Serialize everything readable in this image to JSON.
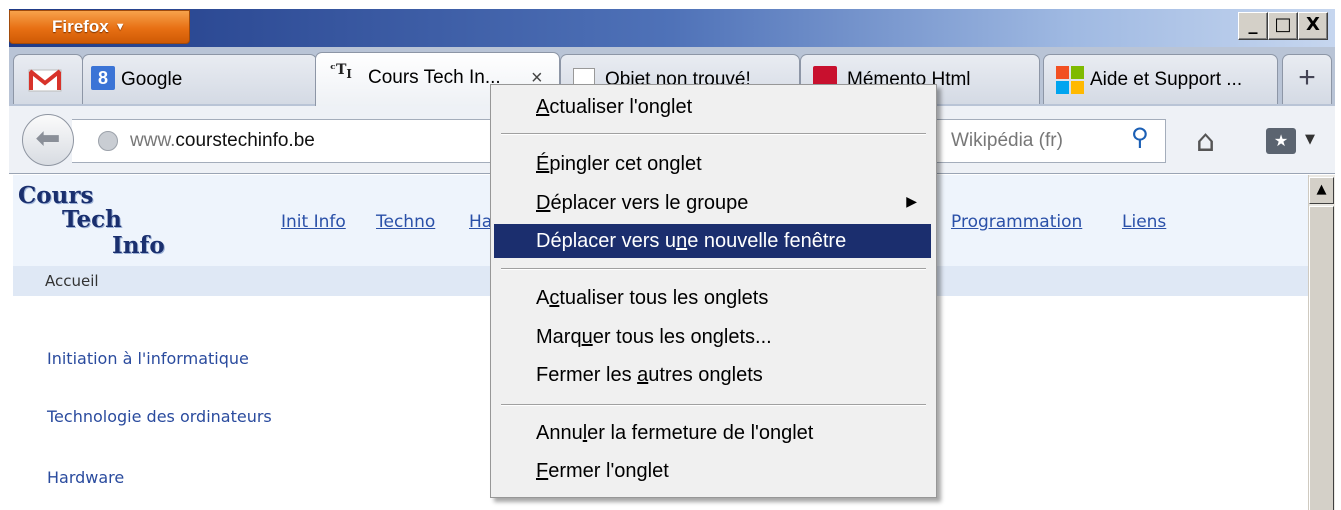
{
  "window": {
    "firefox_button": "Firefox",
    "controls": [
      "_",
      "□",
      "X"
    ]
  },
  "tabs": [
    {
      "label": "",
      "icon": "gmail-icon"
    },
    {
      "label": "Google",
      "icon": "google-icon"
    },
    {
      "label": "Cours Tech In...",
      "icon": "cti-icon",
      "close": "×"
    },
    {
      "label": "Objet non trouvé!",
      "icon": "blank-page-icon"
    },
    {
      "label": "Mémento Html",
      "icon": "pdf-icon"
    },
    {
      "label": "Aide et Support ...",
      "icon": "windows-icon"
    }
  ],
  "new_tab_label": "+",
  "navbar": {
    "url_prefix": "www.",
    "url_domain": "courstechinfo.be",
    "search_placeholder": "Wikipédia (fr)"
  },
  "site": {
    "logo": [
      "Cours",
      "Tech",
      "Info"
    ],
    "nav": [
      "Init Info",
      "Techno",
      "Ha",
      "Programmation",
      "Liens"
    ],
    "breadcrumb": "Accueil",
    "links": [
      "Initiation à l'informatique",
      "Technologie des ordinateurs",
      "Hardware"
    ]
  },
  "context_menu": {
    "items": [
      {
        "pre": "",
        "key": "A",
        "post": "ctualiser l'onglet"
      },
      {
        "pre": "",
        "key": "É",
        "post": "pingler cet onglet"
      },
      {
        "pre": "",
        "key": "D",
        "post": "éplacer vers le groupe",
        "submenu": "▶"
      },
      {
        "pre": "Déplacer vers u",
        "key": "n",
        "post": "e nouvelle fenêtre"
      },
      {
        "pre": "A",
        "key": "c",
        "post": "tualiser tous les onglets"
      },
      {
        "pre": "Marq",
        "key": "u",
        "post": "er tous les onglets..."
      },
      {
        "pre": "Fermer les ",
        "key": "a",
        "post": "utres onglets"
      },
      {
        "pre": "Annu",
        "key": "l",
        "post": "er la fermeture de l'onglet"
      },
      {
        "pre": "",
        "key": "F",
        "post": "ermer l'onglet"
      }
    ]
  }
}
